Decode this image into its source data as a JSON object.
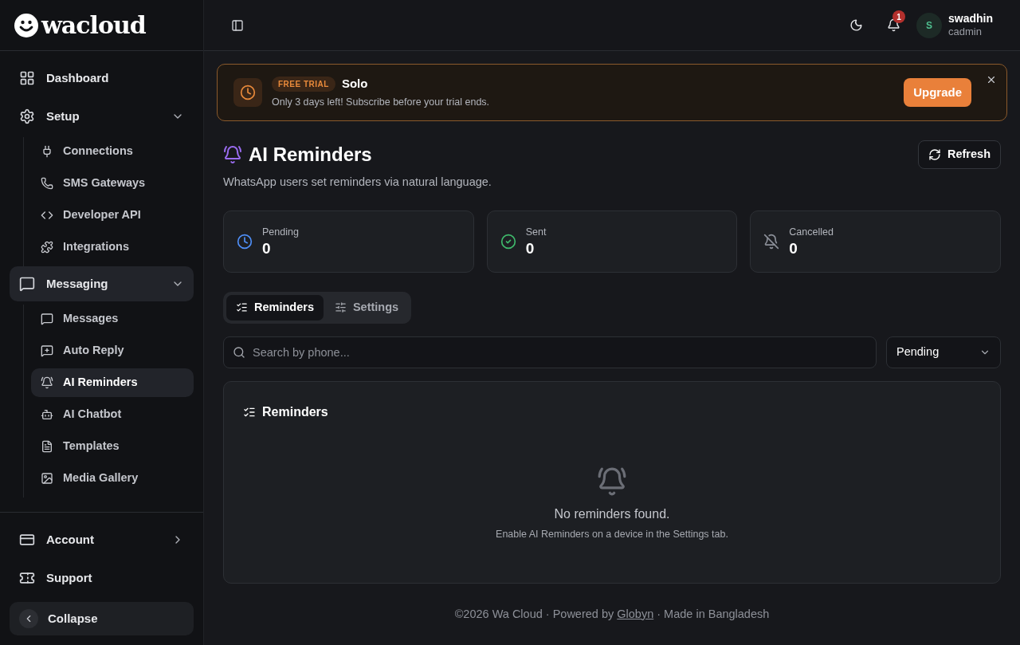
{
  "logo": {
    "text": "wacloud"
  },
  "sidebar": {
    "nav": [
      {
        "label": "Dashboard",
        "kind": "link",
        "selected": false
      },
      {
        "label": "Setup",
        "kind": "group",
        "selected": false,
        "expanded": true,
        "children": [
          {
            "label": "Connections",
            "selected": false
          },
          {
            "label": "SMS Gateways",
            "selected": false
          },
          {
            "label": "Developer API",
            "selected": false
          },
          {
            "label": "Integrations",
            "selected": false
          }
        ]
      },
      {
        "label": "Messaging",
        "kind": "group",
        "selected": true,
        "expanded": true,
        "children": [
          {
            "label": "Messages",
            "selected": false
          },
          {
            "label": "Auto Reply",
            "selected": false
          },
          {
            "label": "AI Reminders",
            "selected": true
          },
          {
            "label": "AI Chatbot",
            "selected": false
          },
          {
            "label": "Templates",
            "selected": false
          },
          {
            "label": "Media Gallery",
            "selected": false
          }
        ]
      }
    ],
    "footer": [
      {
        "label": "Account",
        "kind": "submenu"
      },
      {
        "label": "Support",
        "kind": "link"
      }
    ],
    "collapse": {
      "label": "Collapse"
    }
  },
  "header": {
    "notification_count": "1",
    "user": {
      "initial": "S",
      "name": "swadhin",
      "role": "cadmin"
    }
  },
  "banner": {
    "badge": "FREE TRIAL",
    "plan": "Solo",
    "message": "Only 3 days left! Subscribe before your trial ends.",
    "action": "Upgrade"
  },
  "page": {
    "title": "AI Reminders",
    "subtitle": "WhatsApp users set reminders via natural language.",
    "refresh": "Refresh"
  },
  "stats": [
    {
      "label": "Pending",
      "value": "0",
      "kind": "pending"
    },
    {
      "label": "Sent",
      "value": "0",
      "kind": "sent"
    },
    {
      "label": "Cancelled",
      "value": "0",
      "kind": "cancelled"
    }
  ],
  "tabs": [
    {
      "label": "Reminders",
      "selected": true
    },
    {
      "label": "Settings",
      "selected": false
    }
  ],
  "search": {
    "placeholder": "Search by phone..."
  },
  "filter": {
    "value": "Pending"
  },
  "panel": {
    "title": "Reminders",
    "empty_title": "No reminders found.",
    "empty_text": "Enable AI Reminders on a device in the Settings tab."
  },
  "footer": {
    "before": "©2026 Wa Cloud · Powered by ",
    "link": "Globyn",
    "after": " · Made in Bangladesh"
  }
}
